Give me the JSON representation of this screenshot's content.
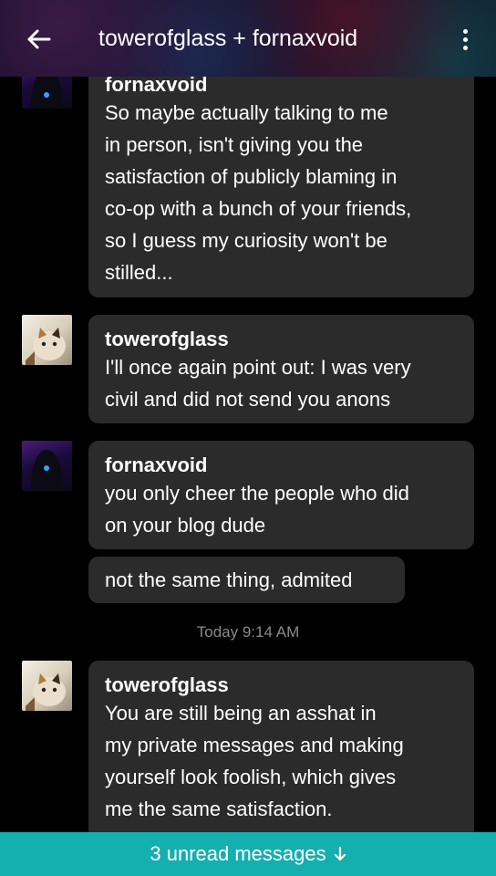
{
  "header": {
    "title": "towerofglass + fornaxvoid",
    "back_icon": "arrow-left-icon",
    "more_icon": "more-vertical-icon"
  },
  "messages": [
    {
      "author": "fornaxvoid",
      "lines": [
        "So maybe actually talking to me",
        "in person, isn't giving you the",
        "satisfaction of publicly blaming in",
        "co-op with a bunch of your friends,",
        "so I guess my curiosity won't be",
        "stilled..."
      ]
    },
    {
      "author": "towerofglass",
      "lines": [
        "I'll once again point out: I was very",
        "civil and did not send you anons"
      ]
    },
    {
      "author": "fornaxvoid",
      "lines": [
        "you only cheer the people who did",
        "on your blog dude"
      ]
    },
    {
      "author": "",
      "lines": [
        "not the same thing, admited"
      ]
    },
    {
      "author": "towerofglass",
      "lines": [
        "You are still being an asshat in",
        "my private messages and making",
        "yourself look foolish, which gives",
        "me the same satisfaction."
      ]
    }
  ],
  "timestamp": "Today 9:14 AM",
  "unread_banner": {
    "label": "3 unread messages",
    "icon": "arrow-down-icon"
  },
  "colors": {
    "bubble": "#2b2b2b",
    "banner": "#14b0b0",
    "background": "#000000"
  }
}
